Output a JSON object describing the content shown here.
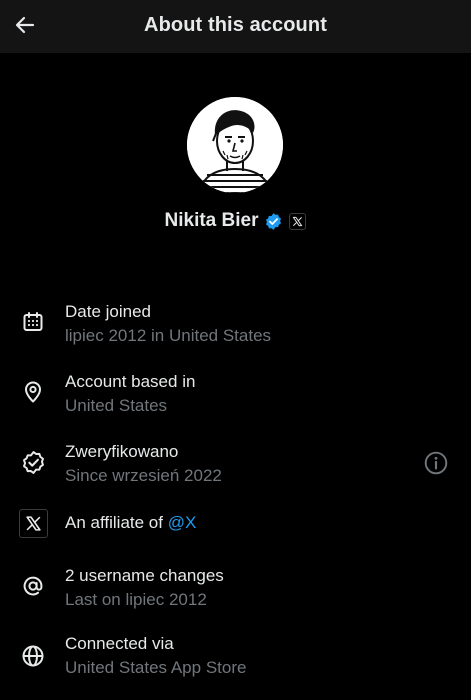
{
  "header": {
    "title": "About this account"
  },
  "profile": {
    "name": "Nikita Bier"
  },
  "rows": [
    {
      "title": "Date joined",
      "subtitle": "lipiec 2012 in United States"
    },
    {
      "title": "Account based in",
      "subtitle": "United States"
    },
    {
      "title": "Zweryfikowano",
      "subtitle": "Since wrzesień 2022"
    },
    {
      "title": "An affiliate of",
      "link": "@X"
    },
    {
      "title": "2 username changes",
      "subtitle": "Last on lipiec 2012"
    },
    {
      "title": "Connected via",
      "subtitle": "United States App Store"
    }
  ],
  "icons": {
    "back": "arrow-left-icon",
    "verified": "verified-badge-icon",
    "affiliate": "x-logo-icon",
    "date": "calendar-icon",
    "location": "location-pin-icon",
    "verification": "verified-outline-icon",
    "info": "info-icon",
    "username": "at-sign-icon",
    "connected": "globe-icon"
  },
  "colors": {
    "background": "#000000",
    "header": "#141414",
    "primary_text": "#e7e9ea",
    "secondary_text": "#71767b",
    "accent": "#1d9bf0"
  }
}
